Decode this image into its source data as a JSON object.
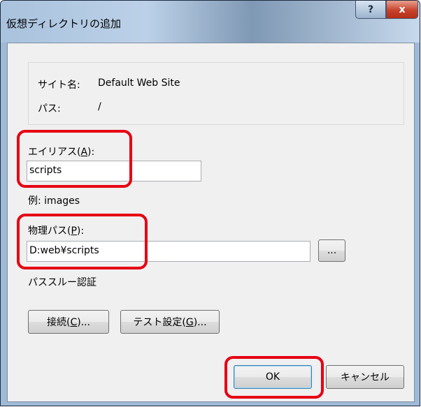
{
  "window": {
    "title": "仮想ディレクトリの追加",
    "help_glyph": "?",
    "close_glyph": "x"
  },
  "info": {
    "site_label": "サイト名:",
    "site_value": "Default Web Site",
    "path_label": "パス:",
    "path_value": "/"
  },
  "alias": {
    "label_pre": "エイリアス(",
    "label_key": "A",
    "label_post": "):",
    "value": "scripts",
    "example": "例: images"
  },
  "physical": {
    "label_pre": "物理パス(",
    "label_key": "P",
    "label_post": "):",
    "value": "D:web¥scripts",
    "browse_label": "..."
  },
  "auth": {
    "label": "パススルー認証",
    "connect_pre": "接続(",
    "connect_key": "C",
    "connect_post": ")...",
    "test_pre": "テスト設定(",
    "test_key": "G",
    "test_post": ")..."
  },
  "footer": {
    "ok_label": "OK",
    "cancel_label": "キャンセル"
  },
  "colors": {
    "highlight": "#e60012",
    "client_bg": "#f0f0f0"
  }
}
